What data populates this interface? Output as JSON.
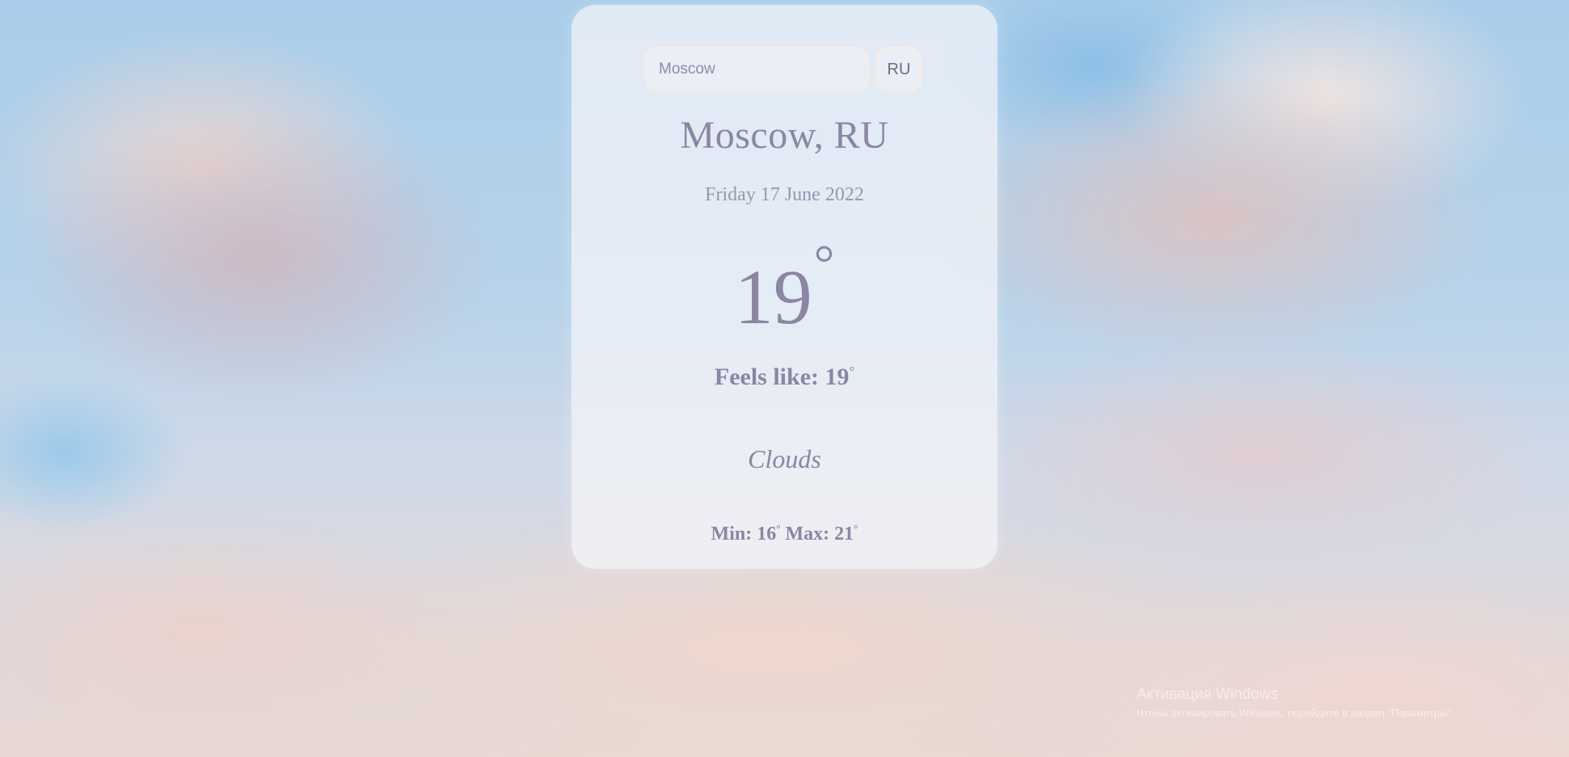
{
  "search": {
    "value": "Moscow",
    "placeholder": "Moscow",
    "country_label": "RU"
  },
  "weather": {
    "location": "Moscow, RU",
    "date": "Friday 17 June 2022",
    "temperature": "19",
    "degree_symbol": "°",
    "feels_like_label": "Feels like: ",
    "feels_like_value": "19",
    "condition": "Clouds",
    "min_label": "Min: ",
    "min_value": "16",
    "max_label": " Max: ",
    "max_value": "21"
  },
  "watermark": {
    "title": "Активация Windows",
    "subtitle": "Чтобы активировать Windows, перейдите в раздел \"Параметры\"."
  },
  "colors": {
    "text": "#8a86a3",
    "card_background": "rgba(245,245,250,0.72)"
  }
}
